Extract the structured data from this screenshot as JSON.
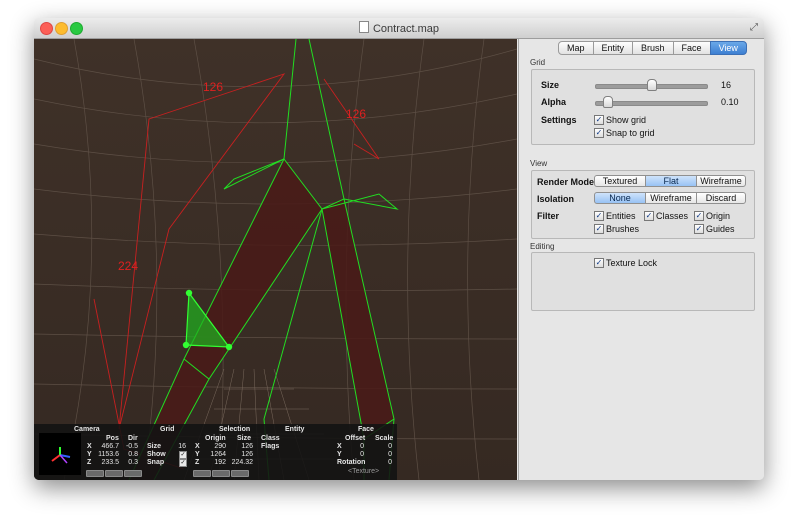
{
  "window": {
    "title": "Contract.map"
  },
  "viewport": {
    "labels": [
      {
        "text": "126"
      },
      {
        "text": "126"
      },
      {
        "text": "224"
      }
    ],
    "label_color": "#e02020",
    "edge_color": "#22dd22"
  },
  "tabs": {
    "items": [
      "Map",
      "Entity",
      "Brush",
      "Face",
      "View"
    ],
    "active": "View"
  },
  "grid_section": {
    "title": "Grid",
    "size_label": "Size",
    "size_value": "16",
    "size_level": 0.62,
    "alpha_label": "Alpha",
    "alpha_value": "0.10",
    "alpha_level": 0.1,
    "settings_label": "Settings",
    "show_grid": "Show grid",
    "snap_to_grid": "Snap to grid"
  },
  "view_section": {
    "title": "View",
    "render_mode_label": "Render Mode",
    "render_modes": [
      "Textured",
      "Flat",
      "Wireframe"
    ],
    "render_selected": "Flat",
    "isolation_label": "Isolation",
    "isolations": [
      "None",
      "Wireframe",
      "Discard"
    ],
    "isolation_selected": "None",
    "filter_label": "Filter",
    "filters": {
      "entities": "Entities",
      "classes": "Classes",
      "origin": "Origin",
      "brushes": "Brushes",
      "guides": "Guides"
    }
  },
  "editing_section": {
    "title": "Editing",
    "texture_lock": "Texture Lock"
  },
  "info_bar": {
    "camera": {
      "title": "Camera",
      "pos_header": "Pos",
      "dir_header": "Dir",
      "rows": [
        {
          "axis": "X",
          "pos": "466.7",
          "dir": "-0.5"
        },
        {
          "axis": "Y",
          "pos": "1153.6",
          "dir": "0.8"
        },
        {
          "axis": "Z",
          "pos": "233.5",
          "dir": "0.3"
        }
      ]
    },
    "grid": {
      "title": "Grid",
      "size_label": "Size",
      "size_value": "16",
      "show_label": "Show",
      "snap_label": "Snap"
    },
    "selection": {
      "title": "Selection",
      "origin_header": "Origin",
      "size_header": "Size",
      "rows": [
        {
          "axis": "X",
          "origin": "290",
          "size": "126"
        },
        {
          "axis": "Y",
          "origin": "1264",
          "size": "126"
        },
        {
          "axis": "Z",
          "origin": "192",
          "size": "224.32"
        }
      ]
    },
    "entity": {
      "title": "Entity",
      "class_label": "Class",
      "flags_label": "Flags"
    },
    "face": {
      "title": "Face",
      "offset_header": "Offset",
      "scale_header": "Scale",
      "rows": [
        {
          "axis": "X",
          "offset": "0",
          "scale": "0"
        },
        {
          "axis": "Y",
          "offset": "0",
          "scale": "0"
        }
      ],
      "rotation_label": "Rotation",
      "rotation_value": "0",
      "texture": "<Texture>"
    }
  }
}
